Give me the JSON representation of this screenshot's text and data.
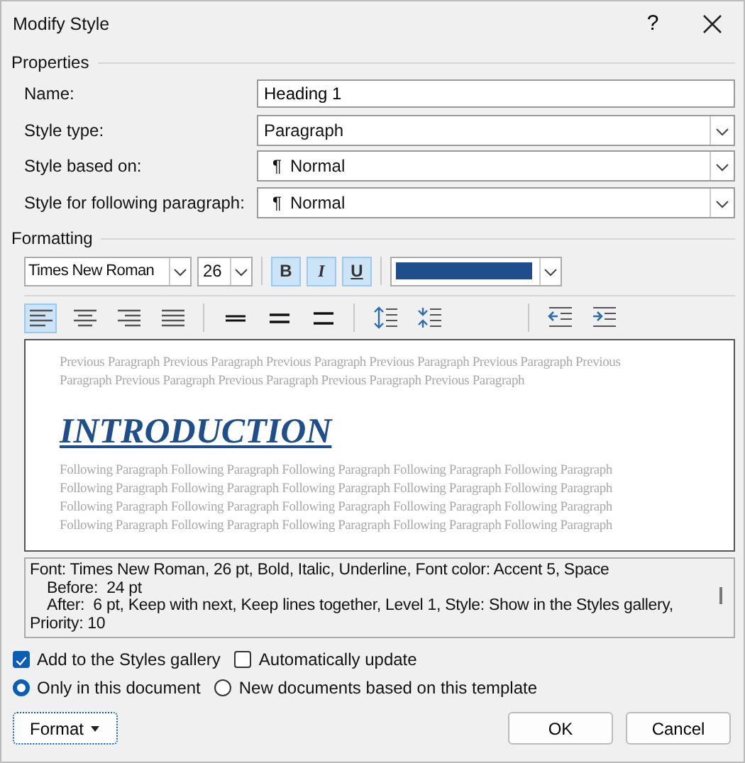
{
  "window": {
    "title": "Modify Style",
    "help": "?"
  },
  "properties": {
    "heading": "Properties",
    "fields": [
      {
        "label": "Name:",
        "kind": "text",
        "value": "Heading 1"
      },
      {
        "label": "Style type:",
        "kind": "dropdown",
        "value": "Paragraph"
      },
      {
        "label": "Style based on:",
        "kind": "dropdown",
        "value": "Normal",
        "mark": "¶"
      },
      {
        "label": "Style for following paragraph:",
        "kind": "dropdown",
        "value": "Normal",
        "mark": "¶"
      }
    ]
  },
  "formatting": {
    "heading": "Formatting",
    "font": "Times New Roman",
    "size": "26",
    "styles": [
      {
        "label": "B",
        "kind": "bold",
        "selected": true
      },
      {
        "label": "I",
        "kind": "italic",
        "selected": true
      },
      {
        "label": "U",
        "kind": "underline",
        "selected": true
      }
    ],
    "alignment": [
      {
        "kind": "left",
        "selected": true
      },
      {
        "kind": "center",
        "selected": false
      },
      {
        "kind": "right",
        "selected": false
      },
      {
        "kind": "justify",
        "selected": false
      }
    ],
    "line_spacing": [
      {
        "kind": "single",
        "selected": false
      },
      {
        "kind": "onehalf",
        "selected": false
      },
      {
        "kind": "double",
        "selected": false
      }
    ]
  },
  "preview": {
    "previous": [
      "Previous Paragraph Previous Paragraph Previous Paragraph Previous Paragraph Previous Paragraph Previous",
      "Paragraph Previous Paragraph Previous Paragraph Previous Paragraph Previous Paragraph"
    ],
    "heading": "INTRODUCTION",
    "following": [
      "Following Paragraph Following Paragraph Following Paragraph Following Paragraph Following Paragraph",
      "Following Paragraph Following Paragraph Following Paragraph Following Paragraph Following Paragraph",
      "Following Paragraph Following Paragraph Following Paragraph Following Paragraph Following Paragraph",
      "Following Paragraph Following Paragraph Following Paragraph Following Paragraph Following Paragraph"
    ]
  },
  "description": [
    {
      "text": "Font: Times New Roman, 26 pt, Bold, Italic, Underline, Font color: Accent 5, Space",
      "indented": false
    },
    {
      "text": "Before:  24 pt",
      "indented": true
    },
    {
      "text": "After:  6 pt, Keep with next, Keep lines together, Level 1, Style: Show in the Styles gallery,",
      "indented": true
    },
    {
      "text": "Priority: 10",
      "indented": false
    }
  ],
  "checkboxes": [
    {
      "label": "Add to the Styles gallery",
      "checked": true
    },
    {
      "label": "Automatically update",
      "checked": false
    }
  ],
  "radios": [
    {
      "label": "Only in this document",
      "selected": true
    },
    {
      "label": "New documents based on this template",
      "selected": false
    }
  ],
  "buttons": {
    "format": "Format",
    "ok": "OK",
    "cancel": "Cancel"
  }
}
